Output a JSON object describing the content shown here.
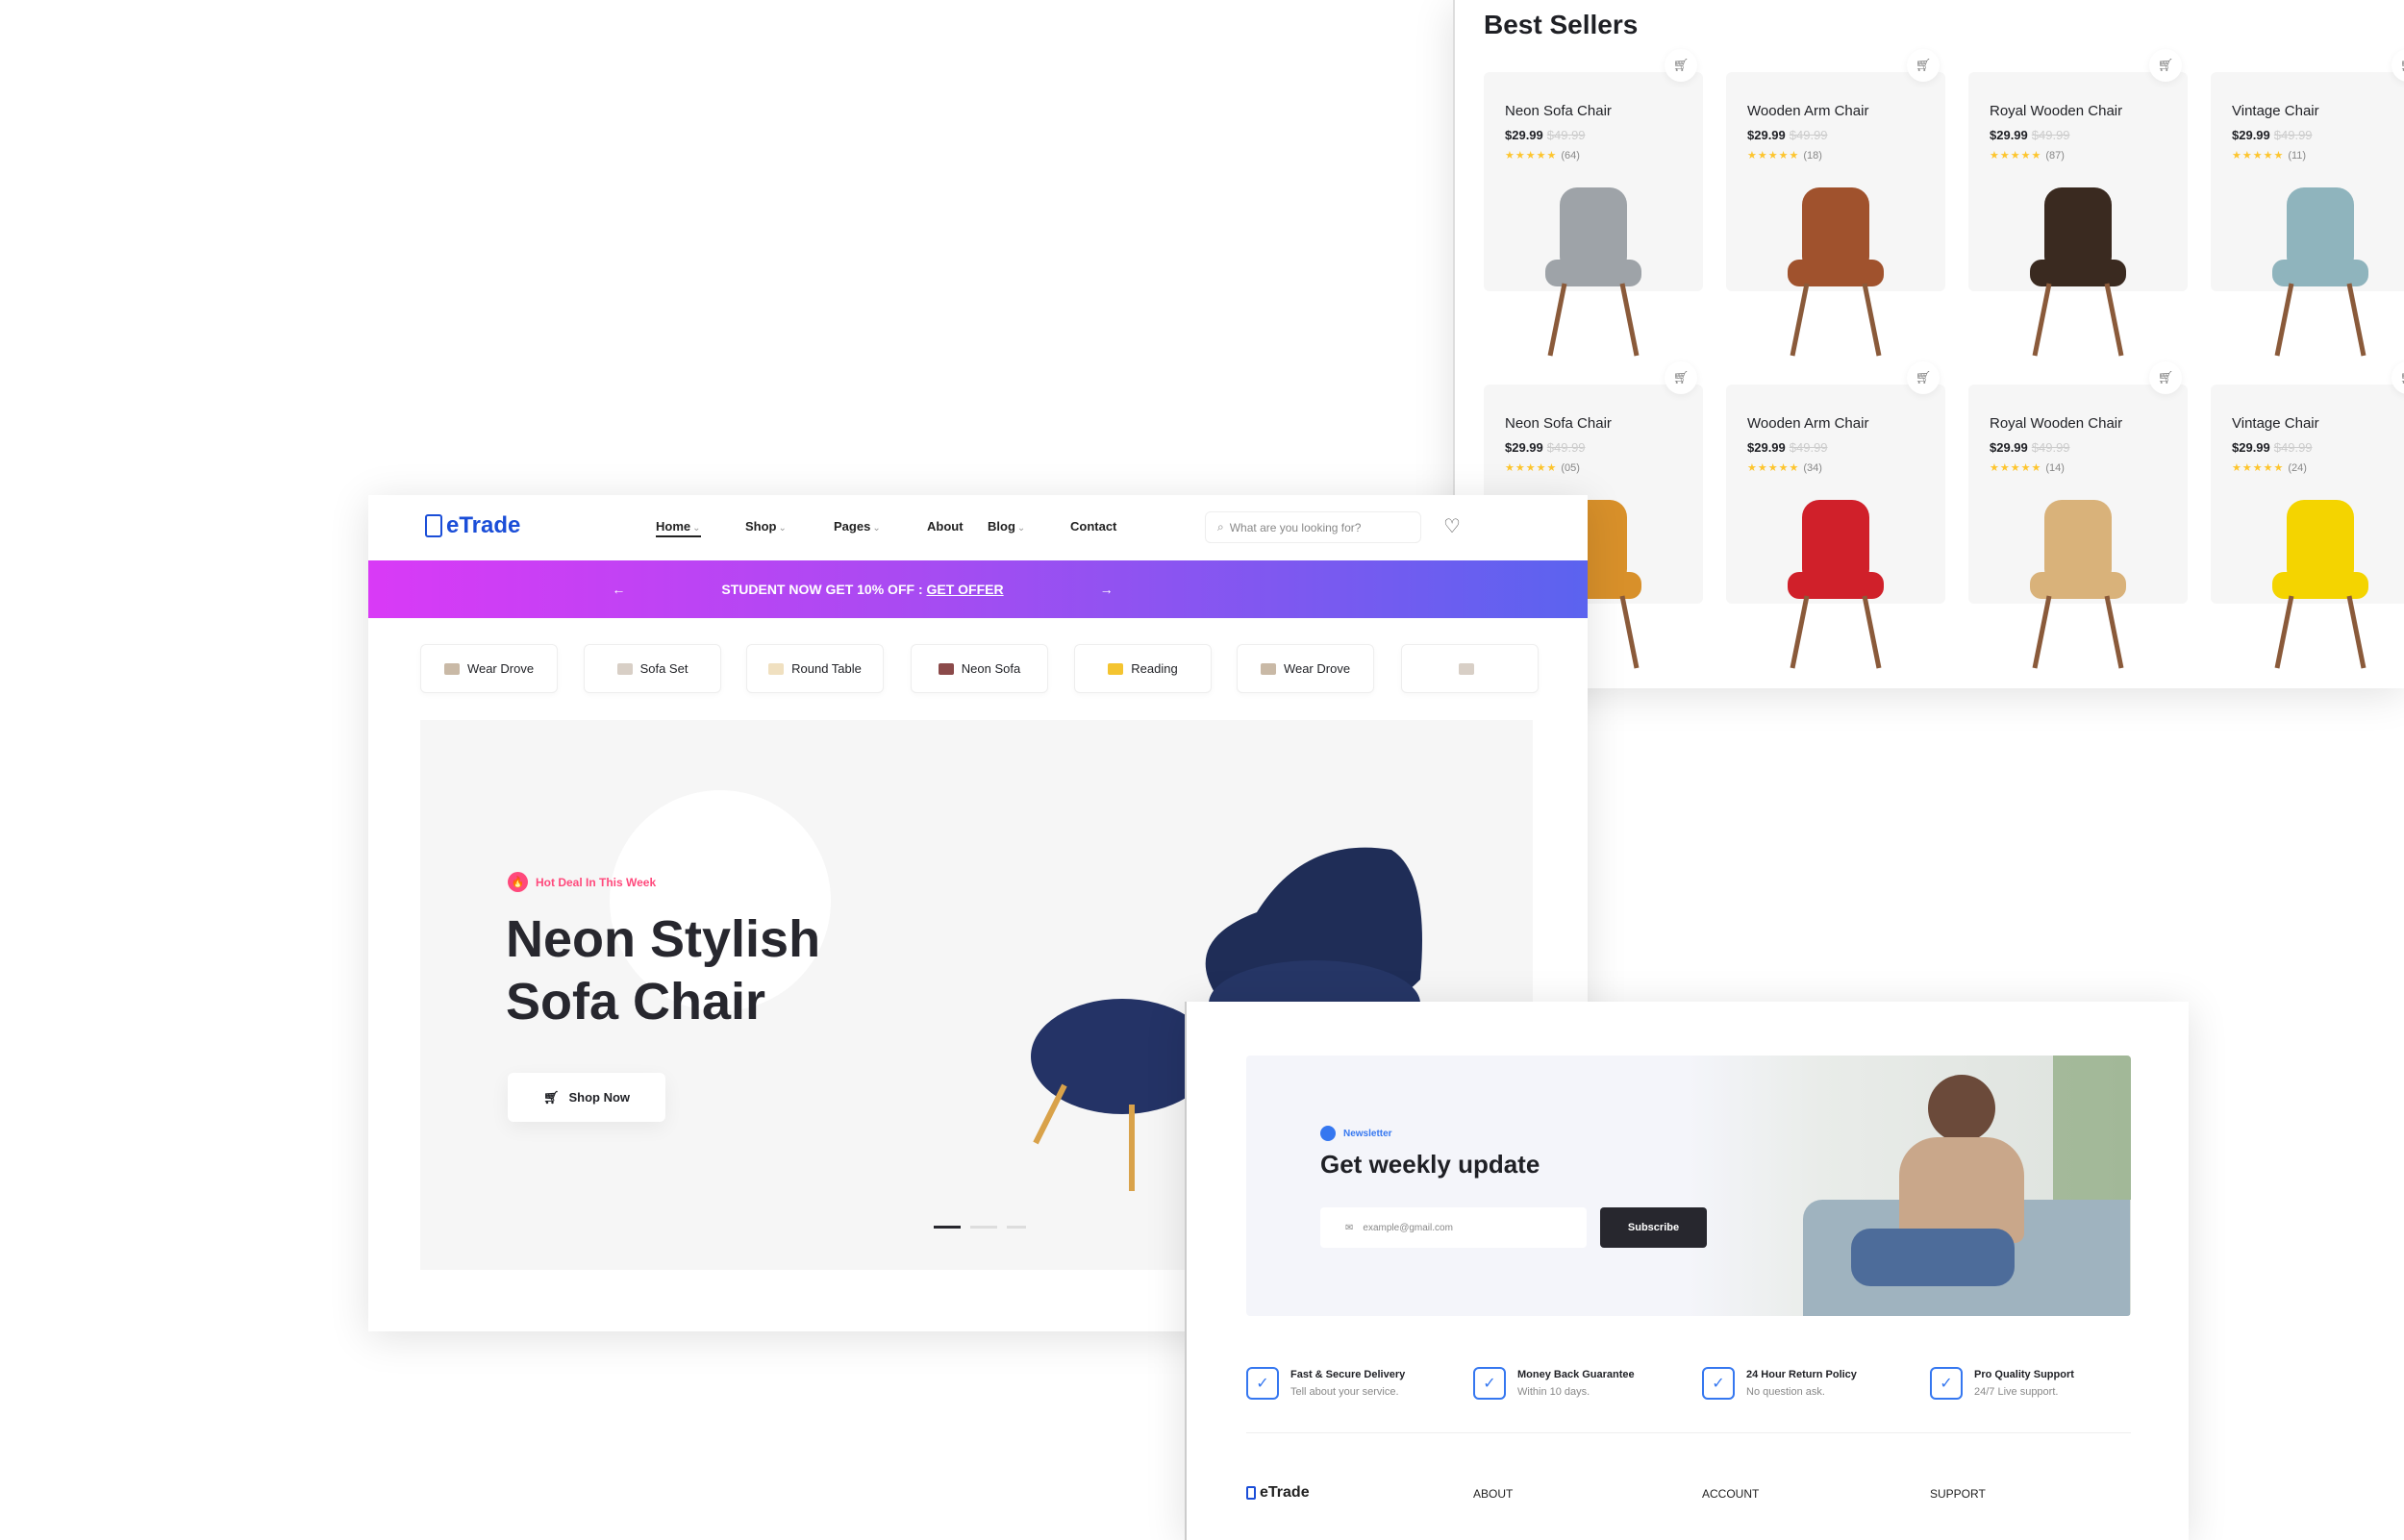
{
  "best_sellers": {
    "title": "Best Sellers",
    "products": [
      {
        "name": "Neon Sofa Chair",
        "price": "$29.99",
        "old_price": "$49.99",
        "stars": "★★★★★",
        "reviews": "(64)",
        "color": "#9ea3a8"
      },
      {
        "name": "Wooden Arm Chair",
        "price": "$29.99",
        "old_price": "$49.99",
        "stars": "★★★★★",
        "reviews": "(18)",
        "color": "#a0522d"
      },
      {
        "name": "Royal Wooden Chair",
        "price": "$29.99",
        "old_price": "$49.99",
        "stars": "★★★★★",
        "reviews": "(87)",
        "color": "#3a2a20"
      },
      {
        "name": "Vintage Chair",
        "price": "$29.99",
        "old_price": "$49.99",
        "stars": "★★★★★",
        "reviews": "(11)",
        "color": "#8fb4bd"
      },
      {
        "name": "Neon Sofa Chair",
        "price": "$29.99",
        "old_price": "$49.99",
        "stars": "★★★★★",
        "reviews": "(05)",
        "color": "#d8902a"
      },
      {
        "name": "Wooden Arm Chair",
        "price": "$29.99",
        "old_price": "$49.99",
        "stars": "★★★★★",
        "reviews": "(34)",
        "color": "#d0202a"
      },
      {
        "name": "Royal Wooden Chair",
        "price": "$29.99",
        "old_price": "$49.99",
        "stars": "★★★★★",
        "reviews": "(14)",
        "color": "#d9b27a"
      },
      {
        "name": "Vintage Chair",
        "price": "$29.99",
        "old_price": "$49.99",
        "stars": "★★★★★",
        "reviews": "(24)",
        "color": "#f4d400"
      }
    ]
  },
  "header": {
    "logo": "eTrade",
    "nav": [
      {
        "label": "Home",
        "dropdown": true,
        "active": true
      },
      {
        "label": "Shop",
        "dropdown": true
      },
      {
        "label": "Pages",
        "dropdown": true
      },
      {
        "label": "About",
        "dropdown": false
      },
      {
        "label": "Blog",
        "dropdown": true
      },
      {
        "label": "Contact",
        "dropdown": false
      }
    ],
    "search_placeholder": "What are you looking for?"
  },
  "promo": {
    "text": "STUDENT NOW GET 10% OFF : ",
    "link": "GET OFFER",
    "prev": "←",
    "next": "→"
  },
  "categories": [
    {
      "label": "Wear Drove",
      "color": "#c9b9a6"
    },
    {
      "label": "Sofa Set",
      "color": "#d8cfc6"
    },
    {
      "label": "Round Table",
      "color": "#f0e0c0"
    },
    {
      "label": "Neon Sofa",
      "color": "#8b4a4a"
    },
    {
      "label": "Reading",
      "color": "#f4c430"
    },
    {
      "label": "Wear Drove",
      "color": "#c9b9a6"
    },
    {
      "label": "",
      "color": "#d8cfc6"
    }
  ],
  "hero": {
    "badge": "Hot Deal In This Week",
    "title_line1": "Neon Stylish",
    "title_line2": "Sofa Chair",
    "button": "Shop Now",
    "slides": 3,
    "active_slide": 1,
    "accent": "#ff497c"
  },
  "newsletter": {
    "label": "Newsletter",
    "title": "Get weekly update",
    "email_placeholder": "example@gmail.com",
    "button": "Subscribe"
  },
  "features": [
    {
      "title": "Fast & Secure Delivery",
      "sub": "Tell about your service.",
      "icon": "delivery-icon"
    },
    {
      "title": "Money Back Guarantee",
      "sub": "Within 10 days.",
      "icon": "badge-check-icon"
    },
    {
      "title": "24 Hour Return Policy",
      "sub": "No question ask.",
      "icon": "return-box-icon"
    },
    {
      "title": "Pro Quality Support",
      "sub": "24/7 Live support.",
      "icon": "support-icon"
    }
  ],
  "footer": {
    "logo": "eTrade",
    "columns": [
      "ABOUT",
      "ACCOUNT",
      "SUPPORT"
    ]
  },
  "colors": {
    "brand": "#3577f0",
    "dark": "#27272e",
    "promo_start": "#d93af6",
    "promo_end": "#5b63ef"
  }
}
